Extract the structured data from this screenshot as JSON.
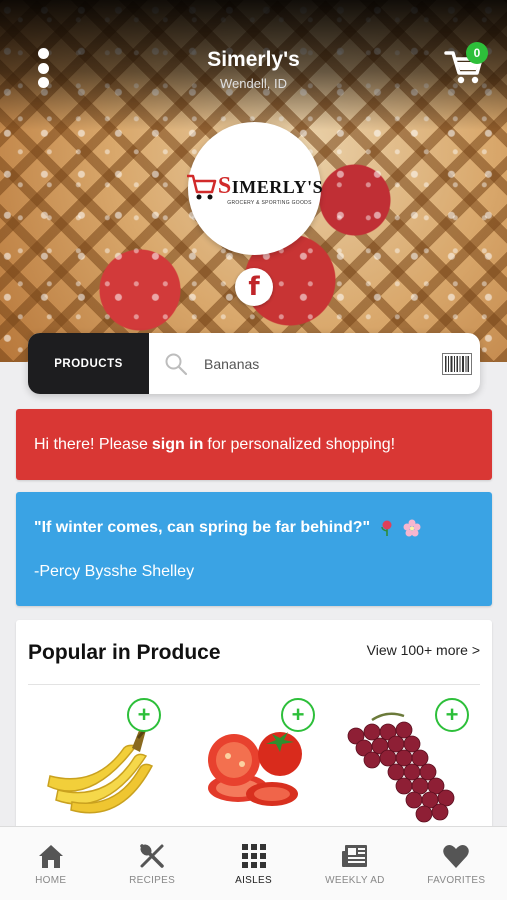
{
  "header": {
    "store_name": "Simerly's",
    "location": "Wendell, ID",
    "cart_count": "0"
  },
  "logo": {
    "name": "IMERLY'S",
    "initial": "S",
    "tagline": "GROCERY & SPORTING GOODS"
  },
  "social": {
    "facebook_glyph": "f"
  },
  "search": {
    "scope_label": "PRODUCTS",
    "placeholder": "Bananas"
  },
  "signin_banner": {
    "prefix": "Hi there! Please",
    "link": "sign in",
    "suffix": "for personalized shopping!"
  },
  "quote": {
    "text": "\"If winter comes, can spring be far behind?\"",
    "author": "-Percy Bysshe Shelley"
  },
  "produce": {
    "title": "Popular in Produce",
    "view_more": "View 100+ more >",
    "add_label": "+",
    "items": [
      {
        "icon": "bananas"
      },
      {
        "icon": "tomatoes"
      },
      {
        "icon": "red-grapes"
      }
    ]
  },
  "tabs": [
    {
      "label": "HOME",
      "icon": "home-icon"
    },
    {
      "label": "RECIPES",
      "icon": "utensils-icon"
    },
    {
      "label": "AISLES",
      "icon": "grid-icon"
    },
    {
      "label": "WEEKLY AD",
      "icon": "newspaper-icon"
    },
    {
      "label": "FAVORITES",
      "icon": "heart-icon"
    }
  ],
  "colors": {
    "accent_green": "#2dbf3a",
    "signin_red": "#d93734",
    "quote_blue": "#3aa3e4",
    "scope_dark": "#1d1d1f"
  }
}
